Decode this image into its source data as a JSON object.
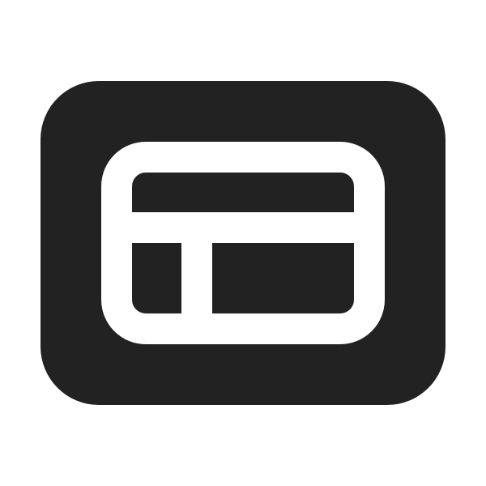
{
  "icon": {
    "name": "layout-panel-icon",
    "background_color": "#ffffff",
    "tile_color": "#222222",
    "glyph_color": "#ffffff"
  }
}
